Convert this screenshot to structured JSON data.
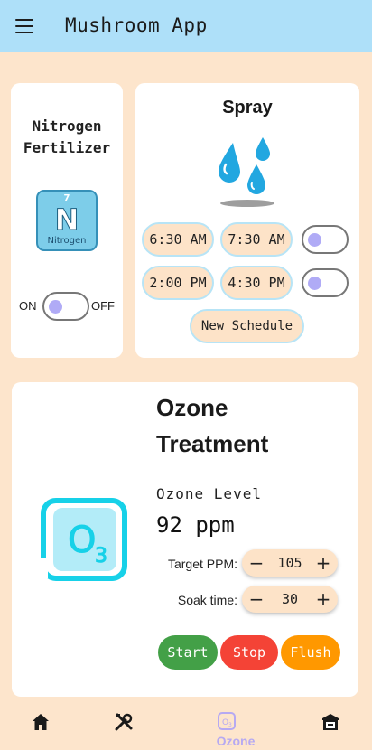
{
  "app_bar": {
    "title": "Mushroom App",
    "menu_icon": "hamburger-menu-icon",
    "background": "#aee0f9"
  },
  "nitrogen": {
    "title": "Nitrogen\nFertilizer",
    "element_number": "7",
    "element_symbol": "N",
    "element_name": "Nitrogen",
    "toggle_on_label": "ON",
    "toggle_off_label": "OFF",
    "toggle_state": "off"
  },
  "spray": {
    "title": "Spray",
    "icon": "water-drops-icon",
    "schedules": [
      {
        "start": "6:30 AM",
        "end": "7:30 AM",
        "enabled": false
      },
      {
        "start": "2:00 PM",
        "end": "4:30 PM",
        "enabled": false
      }
    ],
    "new_schedule_label": "New Schedule"
  },
  "ozone": {
    "title": "Ozone\nTreatment",
    "icon": "ozone-o3-icon",
    "level_label": "Ozone Level",
    "level_value": "92 ppm",
    "target_label": "Target PPM:",
    "target_value": "105",
    "soak_label": "Soak time:",
    "soak_value": "30",
    "minus_symbol": "−",
    "plus_symbol": "+",
    "buttons": {
      "start": "Start",
      "stop": "Stop",
      "flush": "Flush"
    },
    "colors": {
      "start": "#43a047",
      "stop": "#f44336",
      "flush": "#ff9800",
      "accent": "#17d1e8"
    }
  },
  "bottom_nav": {
    "items": [
      {
        "icon": "home-icon",
        "label": ""
      },
      {
        "icon": "tools-icon",
        "label": ""
      },
      {
        "icon": "ozone-nav-icon",
        "label": "Ozone",
        "active": true
      },
      {
        "icon": "storage-bin-icon",
        "label": ""
      }
    ],
    "active_color": "#b6a9f2"
  }
}
